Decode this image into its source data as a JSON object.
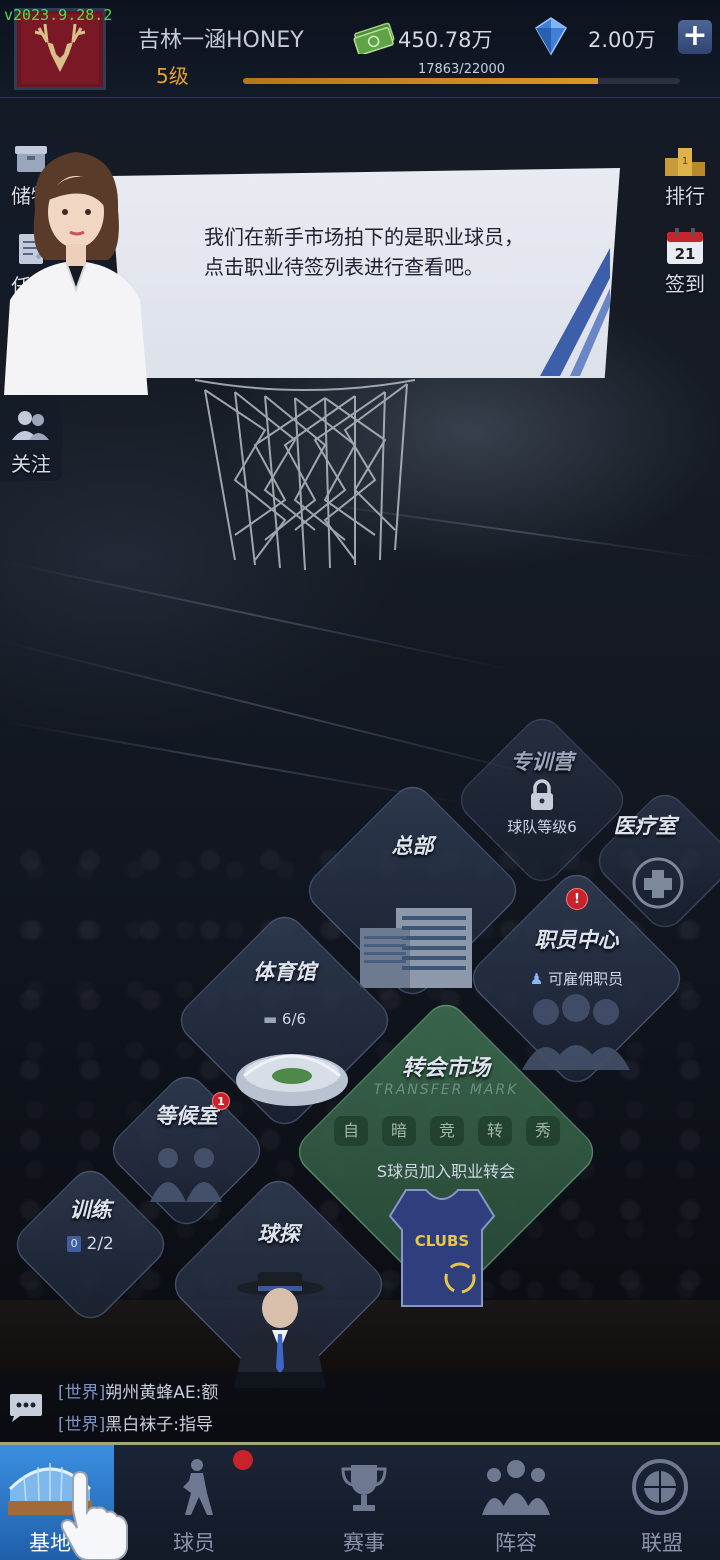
{
  "app": {
    "version": "v2023.9.28.2"
  },
  "player": {
    "name": "吉林一涵HONEY",
    "level": "5级",
    "xp_text": "17863/22000",
    "xp_progress": 0.812
  },
  "currency": {
    "cash": "450.78万",
    "gems": "2.00万",
    "plus_label": "+"
  },
  "left_sidebar": [
    {
      "label": "储物",
      "icon": "box-icon"
    },
    {
      "label": "任务",
      "icon": "task-icon"
    },
    {
      "label": "关注",
      "icon": "users-icon"
    }
  ],
  "right_sidebar": [
    {
      "label": "排行",
      "icon": "podium-icon"
    },
    {
      "label": "签到",
      "icon": "calendar-icon",
      "day": "21"
    }
  ],
  "guide_dialog": {
    "line1": "我们在新手市场拍下的是职业球员，",
    "line2": "点击职业待签列表进行查看吧。"
  },
  "facilities": {
    "training_camp": {
      "title": "专训营",
      "sub": "球队等级6",
      "locked": true
    },
    "headquarters": {
      "title": "总部"
    },
    "medical": {
      "title": "医疗室"
    },
    "staff_center": {
      "title": "职员中心",
      "sub": "可雇佣职员",
      "alert": "!"
    },
    "gym": {
      "title": "体育馆",
      "sub": "6/6"
    },
    "transfer_market": {
      "title": "转会市场",
      "subtitle_en": "TRANSFER MARK",
      "tags": [
        "自",
        "暗",
        "竞",
        "转",
        "秀"
      ],
      "note": "S球员加入职业转会",
      "jersey_text": "CLUBS"
    },
    "waiting_room": {
      "title": "等候室",
      "badge": "1"
    },
    "training": {
      "title": "训练",
      "sub": "2/2",
      "sub_prefix": "0"
    },
    "scout": {
      "title": "球探"
    }
  },
  "chat": {
    "messages": [
      {
        "channel": "[世界]",
        "text": "朔州黄蜂AE:额"
      },
      {
        "channel": "[世界]",
        "text": "黑白袜子:指导"
      }
    ]
  },
  "bottom_nav": [
    {
      "label": "基地",
      "icon": "stadium-icon",
      "active": true
    },
    {
      "label": "球员",
      "icon": "player-icon"
    },
    {
      "label": "赛事",
      "icon": "trophy-icon"
    },
    {
      "label": "阵容",
      "icon": "team-icon"
    },
    {
      "label": "联盟",
      "icon": "union-badge-icon"
    }
  ],
  "colors": {
    "accent_gold": "#e8a125",
    "version_green": "#4be04b",
    "alert_red": "#c6232b",
    "nav_active_blue": "#3b8fe0"
  }
}
